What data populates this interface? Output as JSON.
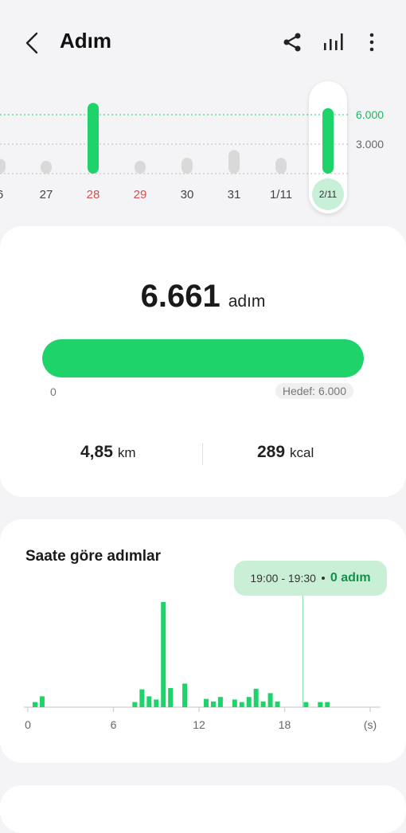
{
  "header": {
    "title": "Adım",
    "back_icon": "chevron-left-icon",
    "share_icon": "share-icon",
    "chart_icon": "bar-chart-icon",
    "more_icon": "more-vertical-icon"
  },
  "daily": {
    "y_labels": [
      "6.000",
      "3.000"
    ],
    "goal": 6000,
    "days": [
      {
        "label": "6",
        "steps": 1500,
        "highlight": false,
        "red": false
      },
      {
        "label": "27",
        "steps": 900,
        "highlight": false,
        "red": false
      },
      {
        "label": "28",
        "steps": 7200,
        "highlight": true,
        "red": true
      },
      {
        "label": "29",
        "steps": 900,
        "highlight": false,
        "red": true
      },
      {
        "label": "30",
        "steps": 1600,
        "highlight": false,
        "red": false
      },
      {
        "label": "31",
        "steps": 2400,
        "highlight": false,
        "red": false
      },
      {
        "label": "1/11",
        "steps": 1600,
        "highlight": false,
        "red": false
      },
      {
        "label": "2/11",
        "steps": 6661,
        "highlight": true,
        "red": false,
        "selected": true
      }
    ]
  },
  "summary": {
    "steps": "6.661",
    "unit": "adım",
    "progress_fraction": 1.0,
    "zero_label": "0",
    "goal_label": "Hedef: 6.000",
    "distance_value": "4,85",
    "distance_unit": "km",
    "calories_value": "289",
    "calories_unit": "kcal"
  },
  "hourly": {
    "title": "Saate göre adımlar",
    "tooltip_range": "19:00 - 19:30",
    "tooltip_value": "0 adım",
    "x_ticks": [
      "0",
      "6",
      "12",
      "18",
      "(s)"
    ],
    "selected_hour": 19.0
  },
  "chart_data": {
    "type": "bar",
    "title": "Saate göre adımlar",
    "xlabel": "(s)",
    "ylabel": "",
    "xlim": [
      0,
      24
    ],
    "x": [
      0.5,
      1.0,
      7.5,
      8.0,
      8.5,
      9.0,
      9.5,
      10.0,
      11.0,
      12.5,
      13.0,
      13.5,
      14.5,
      15.0,
      15.5,
      16.0,
      16.5,
      17.0,
      17.5,
      19.5,
      20.5,
      21.0
    ],
    "values": [
      80,
      170,
      80,
      280,
      170,
      120,
      1650,
      300,
      370,
      130,
      90,
      160,
      120,
      80,
      160,
      290,
      90,
      220,
      90,
      80,
      80,
      80
    ]
  },
  "colors": {
    "accent": "#1ed36a",
    "accent_dark": "#13904a",
    "gray_bar": "#d9d9d9",
    "weekend_red": "#d05050",
    "tooltip_bg": "#c9f0d6"
  }
}
